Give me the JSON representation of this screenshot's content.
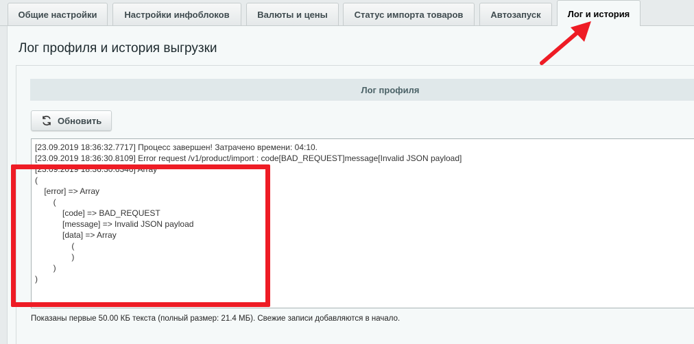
{
  "tabs": [
    {
      "label": "Общие настройки",
      "active": false
    },
    {
      "label": "Настройки инфоблоков",
      "active": false
    },
    {
      "label": "Валюты и цены",
      "active": false
    },
    {
      "label": "Статус импорта товаров",
      "active": false
    },
    {
      "label": "Автозапуск",
      "active": false
    },
    {
      "label": "Лог и история",
      "active": true
    }
  ],
  "page_title": "Лог профиля и история выгрузки",
  "section_header": "Лог профиля",
  "refresh_button": {
    "label": "Обновить",
    "icon": "refresh-icon"
  },
  "log_lines": [
    "[23.09.2019 18:36:32.7717] Процесс завершен! Затрачено времени: 04:10.",
    "[23.09.2019 18:36:30.8109] Error request /v1/product/import : code[BAD_REQUEST]message[Invalid JSON payload]",
    "[23.09.2019 18:36:30.6346] Array",
    "(",
    "    [error] => Array",
    "        (",
    "            [code] => BAD_REQUEST",
    "            [message] => Invalid JSON payload",
    "            [data] => Array",
    "                (",
    "                )",
    "",
    "        )",
    "",
    ")"
  ],
  "footer_note": "Показаны первые 50.00 КБ текста (полный размер: 21.4 МБ). Свежие записи добавляются в начало.",
  "colors": {
    "highlight": "#ee1c25",
    "arrow": "#ee1c25"
  }
}
